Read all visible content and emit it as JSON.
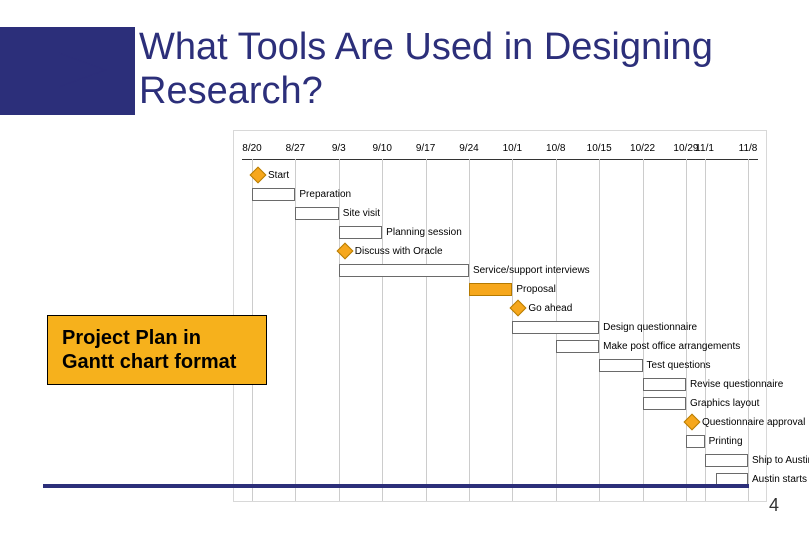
{
  "slide": {
    "title": "What Tools Are Used in Designing Research?",
    "callout": "Project Plan in Gantt chart format",
    "pageNumber": "4"
  },
  "chart_data": {
    "type": "gantt",
    "title": "Project Plan",
    "dates": [
      "8/20",
      "8/27",
      "9/3",
      "9/10",
      "9/17",
      "9/24",
      "10/1",
      "10/8",
      "10/15",
      "10/22",
      "10/29",
      "11/1",
      "11/8"
    ],
    "tasks": [
      {
        "name": "Start",
        "type": "milestone",
        "start": "8/20"
      },
      {
        "name": "Preparation",
        "type": "bar",
        "start": "8/20",
        "end": "8/27"
      },
      {
        "name": "Site visit",
        "type": "bar",
        "start": "8/27",
        "end": "9/3"
      },
      {
        "name": "Planning session",
        "type": "bar",
        "start": "9/3",
        "end": "9/10"
      },
      {
        "name": "Discuss with Oracle",
        "type": "milestone",
        "start": "9/3"
      },
      {
        "name": "Service/support interviews",
        "type": "bar",
        "start": "9/3",
        "end": "9/24"
      },
      {
        "name": "Proposal",
        "type": "bar",
        "style": "highlight",
        "start": "9/24",
        "end": "10/1"
      },
      {
        "name": "Go ahead",
        "type": "milestone",
        "start": "10/1"
      },
      {
        "name": "Design questionnaire",
        "type": "bar",
        "start": "10/1",
        "end": "10/15"
      },
      {
        "name": "Make post office arrangements",
        "type": "bar",
        "start": "10/8",
        "end": "10/15"
      },
      {
        "name": "Test questions",
        "type": "bar",
        "start": "10/15",
        "end": "10/22"
      },
      {
        "name": "Revise questionnaire",
        "type": "bar",
        "start": "10/22",
        "end": "10/29"
      },
      {
        "name": "Graphics layout",
        "type": "bar",
        "start": "10/22",
        "end": "10/29"
      },
      {
        "name": "Questionnaire approval",
        "type": "milestone",
        "start": "10/29"
      },
      {
        "name": "Printing",
        "type": "bar",
        "start": "10/29",
        "end": "11/1"
      },
      {
        "name": "Ship to Austin",
        "type": "bar",
        "start": "11/1",
        "end": "11/8"
      },
      {
        "name": "Austin starts postcards",
        "type": "bar",
        "start": "11/3",
        "end": "11/8"
      }
    ]
  }
}
